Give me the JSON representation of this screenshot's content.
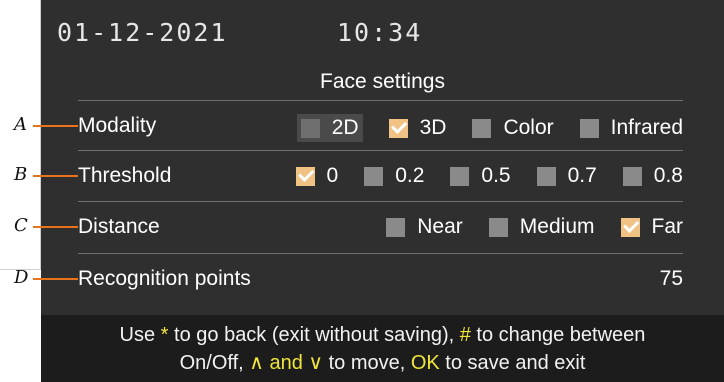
{
  "header": {
    "date": "01-12-2021",
    "time": "10:34"
  },
  "title": "Face settings",
  "rows": [
    {
      "callout": "A",
      "label": "Modality",
      "options": [
        {
          "label": "2D",
          "checked": false,
          "focused": true
        },
        {
          "label": "3D",
          "checked": true
        },
        {
          "label": "Color",
          "checked": false
        },
        {
          "label": "Infrared",
          "checked": false
        }
      ]
    },
    {
      "callout": "B",
      "label": "Threshold",
      "options": [
        {
          "label": "0",
          "checked": true
        },
        {
          "label": "0.2",
          "checked": false
        },
        {
          "label": "0.5",
          "checked": false
        },
        {
          "label": "0.7",
          "checked": false
        },
        {
          "label": "0.8",
          "checked": false
        }
      ]
    },
    {
      "callout": "C",
      "label": "Distance",
      "options": [
        {
          "label": "Near",
          "checked": false
        },
        {
          "label": "Medium",
          "checked": false
        },
        {
          "label": "Far",
          "checked": true
        }
      ]
    },
    {
      "callout": "D",
      "label": "Recognition points",
      "value": "75"
    }
  ],
  "footer": {
    "l1_a": "Use ",
    "l1_star": "*",
    "l1_b": " to go back (exit without saving), ",
    "l1_hash": "#",
    "l1_c": " to change between",
    "l2_a": "On/Off, ",
    "l2_arrows": "∧ and ∨",
    "l2_b": " to move, ",
    "l2_ok": "OK",
    "l2_c": " to save and exit"
  },
  "colors": {
    "screen_bg": "#2f2f2f",
    "checked": "#f0c284",
    "unchecked": "#8a8a8a",
    "highlight": "#f0e53a",
    "callout_line": "#e8731c"
  }
}
